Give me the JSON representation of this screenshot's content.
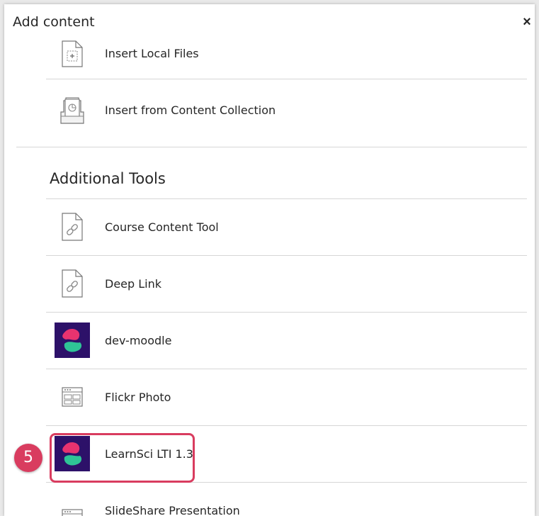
{
  "dialog": {
    "title": "Add content",
    "close_label": "×"
  },
  "items": [
    {
      "label": "Insert Local Files",
      "icon": "file-upload-icon"
    },
    {
      "label": "Insert from Content Collection",
      "icon": "content-collection-icon"
    }
  ],
  "additional_tools": {
    "heading": "Additional Tools",
    "items": [
      {
        "label": "Course Content Tool",
        "icon": "link-file-icon"
      },
      {
        "label": "Deep Link",
        "icon": "link-file-icon"
      },
      {
        "label": "dev-moodle",
        "icon": "learnsci-logo-icon"
      },
      {
        "label": "Flickr Photo",
        "icon": "browser-window-icon"
      },
      {
        "label": "LearnSci LTI 1.3",
        "icon": "learnsci-logo-icon"
      },
      {
        "label": "SlideShare Presentation",
        "icon": "browser-window-icon"
      }
    ]
  },
  "step_badge": "5",
  "colors": {
    "accent": "#d93c5f",
    "logo_bg": "#2d1169",
    "logo_pink": "#e8336f",
    "logo_green": "#2fc496",
    "divider": "#d6d6d6"
  }
}
